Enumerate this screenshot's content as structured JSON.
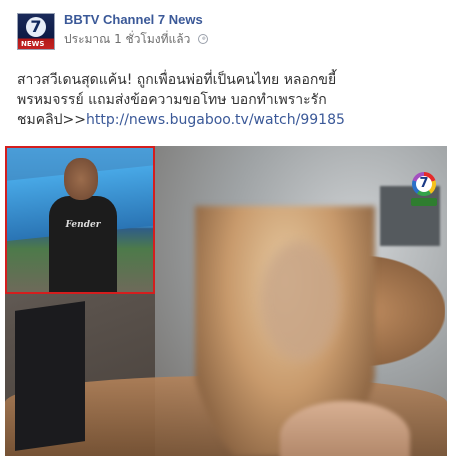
{
  "post": {
    "page_name": "BBTV Channel 7 News",
    "timestamp": "ประมาณ 1 ชั่วโมงที่แล้ว",
    "text_line1": "สาวสวีเดนสุดแค้น! ถูกเพื่อนพ่อที่เป็นคนไทย หลอกขยี้",
    "text_line2": "พรหมจรรย์ แถมส่งข้อความขอโทษ บอกทำเพราะรัก",
    "text_line3_prefix": "ชมคลิป>>",
    "link": "http://news.bugaboo.tv/watch/99185",
    "avatar_label": "7",
    "avatar_caption": "NEWS",
    "inset_shirt_text": "Fender"
  },
  "icons": {
    "globe": "globe-icon",
    "channel_logo": "channel-7-logo"
  },
  "colors": {
    "page_name": "#3b5998",
    "link": "#3b5998",
    "inset_border": "#d41e1e"
  }
}
